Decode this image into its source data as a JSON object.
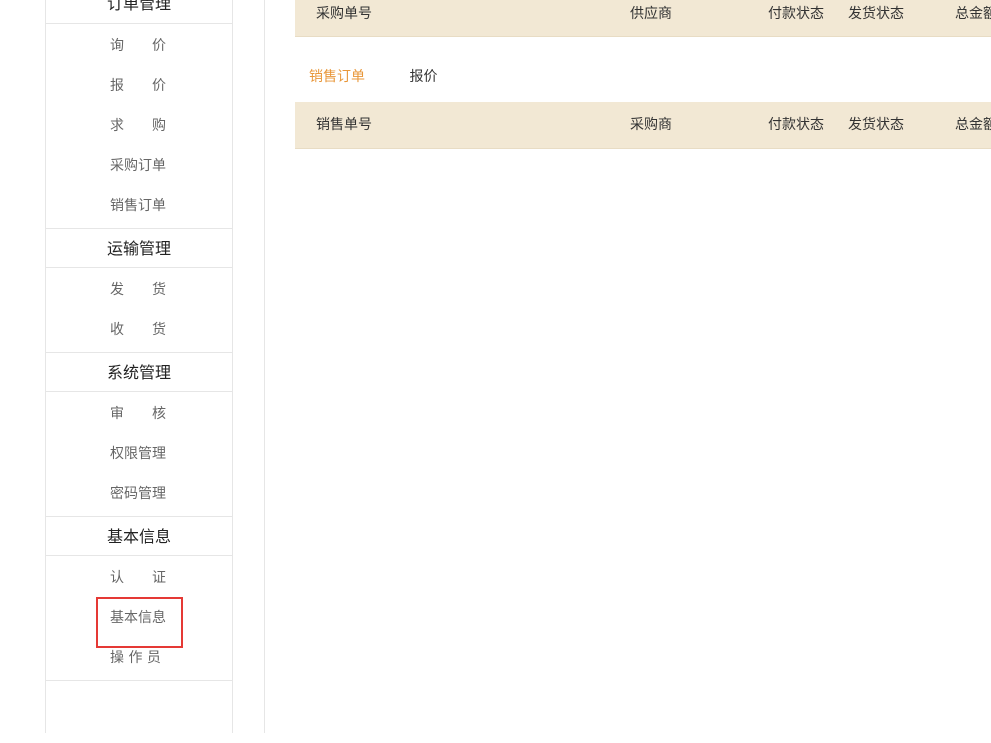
{
  "sidebar": {
    "sections": [
      {
        "title": "订单管理",
        "items": [
          "询　　价",
          "报　　价",
          "求　　购",
          "采购订单",
          "销售订单"
        ]
      },
      {
        "title": "运输管理",
        "items": [
          "发　　货",
          "收　　货"
        ]
      },
      {
        "title": "系统管理",
        "items": [
          "审　　核",
          "权限管理",
          "密码管理"
        ]
      },
      {
        "title": "基本信息",
        "items": [
          "认　　证",
          "基本信息",
          "操 作 员"
        ]
      }
    ]
  },
  "purchase_table": {
    "columns": [
      "采购单号",
      "供应商",
      "付款状态",
      "发货状态",
      "总金额"
    ]
  },
  "tabs": [
    {
      "label": "销售订单",
      "active": true
    },
    {
      "label": "报价",
      "active": false
    }
  ],
  "sales_table": {
    "columns": [
      "销售单号",
      "采购商",
      "付款状态",
      "发货状态",
      "总金额"
    ]
  },
  "highlight_color": "#e53935",
  "accent_color": "#e8973a",
  "header_bg_color": "#f2e8d4"
}
